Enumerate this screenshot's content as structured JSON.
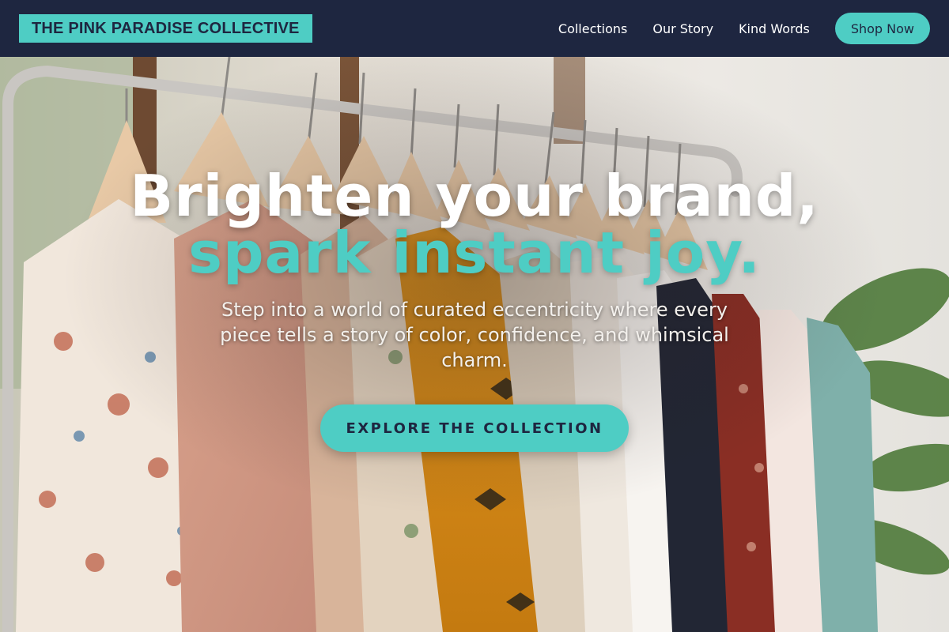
{
  "header": {
    "logo_text": "THE PINK PARADISE COLLECTIVE",
    "nav": [
      {
        "label": "Collections"
      },
      {
        "label": "Our Story"
      },
      {
        "label": "Kind Words"
      }
    ],
    "shop_button": "Shop Now"
  },
  "hero": {
    "headline_line1": "Brighten your brand,",
    "headline_line2": "spark instant joy.",
    "subtext": "Step into a world of curated eccentricity where every piece tells a story of color, confidence, and whimsical charm.",
    "cta_label": "EXPLORE THE COLLECTION",
    "background_image": "clothing-rack-photo"
  },
  "colors": {
    "accent": "#4ecdc4",
    "header_bg": "#1e2640",
    "text_light": "#ffffff"
  }
}
